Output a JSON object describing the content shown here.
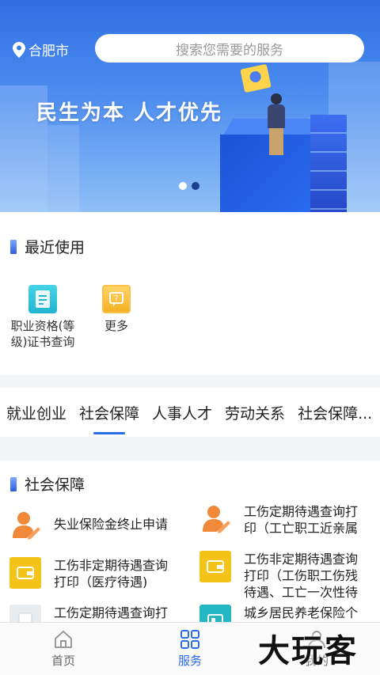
{
  "header": {
    "city": "合肥市",
    "search_placeholder": "搜索您需要的服务"
  },
  "banner": {
    "slogan": "民生为本 人才优先",
    "dot_count": 2,
    "active_dot": 1
  },
  "recent": {
    "title": "最近使用",
    "items": [
      {
        "label": "职业资格(等级)证书查询",
        "icon": "certificate-icon"
      },
      {
        "label": "更多",
        "icon": "more-icon"
      }
    ]
  },
  "tabs": {
    "items": [
      "就业创业",
      "社会保障",
      "人事人才",
      "劳动关系",
      "社会保障..."
    ],
    "active_index": 1
  },
  "services": {
    "title": "社会保障",
    "items": [
      {
        "label": "失业保险金终止申请",
        "icon": "person-edit-icon"
      },
      {
        "label": "工伤定期待遇查询打印（工亡职工近亲属",
        "icon": "person-edit-icon"
      },
      {
        "label": "工伤非定期待遇查询打印（医疗待遇)",
        "icon": "wallet-icon"
      },
      {
        "label": "工伤非定期待遇查询打印（工伤职工伤残待遇、工亡一次性待",
        "icon": "wallet-icon"
      },
      {
        "label": "工伤定期待遇查询打",
        "icon": "document-icon"
      },
      {
        "label": "城乡居民养老保险个",
        "icon": "id-card-icon"
      }
    ]
  },
  "bottom_nav": {
    "items": [
      {
        "label": "首页",
        "icon": "home-icon"
      },
      {
        "label": "服务",
        "icon": "grid-icon"
      },
      {
        "label": "我的",
        "icon": "user-icon"
      }
    ],
    "active_index": 1
  },
  "watermark": "大玩客",
  "colors": {
    "accent": "#2a6be8",
    "banner_top": "#2f6fe2",
    "wallet": "#f3c318",
    "person_icon": "#f08a3a"
  }
}
